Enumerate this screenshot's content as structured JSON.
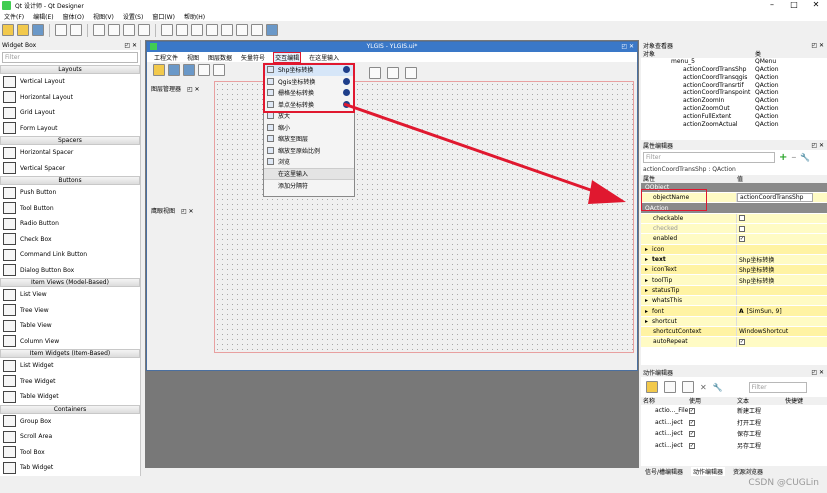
{
  "app": {
    "title": "Qt 设计师 - Qt Designer"
  },
  "menubar": [
    "文件(F)",
    "编辑(E)",
    "窗体(O)",
    "视图(V)",
    "设置(S)",
    "窗口(W)",
    "帮助(H)"
  ],
  "widget_box": {
    "title": "Widget Box",
    "filter_placeholder": "Filter",
    "categories": [
      {
        "name": "Layouts",
        "items": [
          "Vertical Layout",
          "Horizontal Layout",
          "Grid Layout",
          "Form Layout"
        ]
      },
      {
        "name": "Spacers",
        "items": [
          "Horizontal Spacer",
          "Vertical Spacer"
        ]
      },
      {
        "name": "Buttons",
        "items": [
          "Push Button",
          "Tool Button",
          "Radio Button",
          "Check Box",
          "Command Link Button",
          "Dialog Button Box"
        ]
      },
      {
        "name": "Item Views (Model-Based)",
        "items": [
          "List View",
          "Tree View",
          "Table View",
          "Column View"
        ]
      },
      {
        "name": "Item Widgets (Item-Based)",
        "items": [
          "List Widget",
          "Tree Widget",
          "Table Widget"
        ]
      },
      {
        "name": "Containers",
        "items": [
          "Group Box",
          "Scroll Area",
          "Tool Box",
          "Tab Widget"
        ]
      }
    ]
  },
  "form": {
    "title": "YLGIS - YLGIS.ui*",
    "menus": [
      "工程文件",
      "视图",
      "图层数据",
      "矢量符号",
      "交互编辑",
      "在这里输入"
    ],
    "dock_left": "图层管理器",
    "dock_eagle": "鹰眼视图",
    "dropdown_items": [
      {
        "label": "Shp坐标转换",
        "icon": "action-icon",
        "group": "red"
      },
      {
        "label": "Qgis坐标转换",
        "icon": "action-icon",
        "group": "red"
      },
      {
        "label": "栅格坐标转换",
        "icon": "action-icon",
        "group": "red"
      },
      {
        "label": "单点坐标转换",
        "icon": "action-icon",
        "group": "red"
      },
      {
        "label": "放大",
        "icon": "zoom-in-icon"
      },
      {
        "label": "缩小",
        "icon": "zoom-out-icon"
      },
      {
        "label": "缩放至图层",
        "icon": "zoom-layer-icon"
      },
      {
        "label": "缩放至原始比例",
        "icon": "zoom-original-icon"
      },
      {
        "label": "浏览",
        "icon": "pan-hand-icon"
      },
      {
        "label": "在这里输入",
        "icon": ""
      },
      {
        "label": "添加分隔符",
        "icon": ""
      }
    ]
  },
  "object_inspector": {
    "title": "对象查看器",
    "headers": [
      "对象",
      "类"
    ],
    "rows": [
      {
        "object": "menu_5",
        "class": "QMenu",
        "indent": 1
      },
      {
        "object": "actionCoordTransShp",
        "class": "QAction",
        "indent": 2
      },
      {
        "object": "actionCoordTransqgis",
        "class": "QAction",
        "indent": 2
      },
      {
        "object": "actionCoordTransrtif",
        "class": "QAction",
        "indent": 2
      },
      {
        "object": "actionCoordTranspoint",
        "class": "QAction",
        "indent": 2
      },
      {
        "object": "actionZoomIn",
        "class": "QAction",
        "indent": 2
      },
      {
        "object": "actionZoomOut",
        "class": "QAction",
        "indent": 2
      },
      {
        "object": "actionFullExtent",
        "class": "QAction",
        "indent": 2
      },
      {
        "object": "actionZoomActual",
        "class": "QAction",
        "indent": 2
      }
    ]
  },
  "property_editor": {
    "title": "属性编辑器",
    "filter_placeholder": "Filter",
    "context": "actionCoordTransShp : QAction",
    "headers": [
      "属性",
      "值"
    ],
    "rows": [
      {
        "k": "QObject",
        "v": "",
        "type": "group"
      },
      {
        "k": "objectName",
        "v": "actionCoordTransShp",
        "type": "yel"
      },
      {
        "k": "QAction",
        "v": "",
        "type": "group"
      },
      {
        "k": "checkable",
        "v": "",
        "type": "yel",
        "check": false
      },
      {
        "k": "checked",
        "v": "",
        "type": "yel",
        "check": false,
        "dim": true
      },
      {
        "k": "enabled",
        "v": "",
        "type": "yel",
        "check": true
      },
      {
        "k": "icon",
        "v": "",
        "type": "yel2",
        "expand": true
      },
      {
        "k": "text",
        "v": "Shp坐标转换",
        "type": "yel",
        "expand": true,
        "bold": true
      },
      {
        "k": "iconText",
        "v": "Shp坐标转换",
        "type": "yel2",
        "expand": true
      },
      {
        "k": "toolTip",
        "v": "Shp坐标转换",
        "type": "yel",
        "expand": true
      },
      {
        "k": "statusTip",
        "v": "",
        "type": "yel2",
        "expand": true
      },
      {
        "k": "whatsThis",
        "v": "",
        "type": "yel",
        "expand": true
      },
      {
        "k": "font",
        "v": "[SimSun, 9]",
        "type": "yel2",
        "expand": true,
        "font": "A"
      },
      {
        "k": "shortcut",
        "v": "",
        "type": "yel",
        "expand": true
      },
      {
        "k": "shortcutContext",
        "v": "WindowShortcut",
        "type": "yel2"
      },
      {
        "k": "autoRepeat",
        "v": "",
        "type": "yel",
        "check": true
      }
    ]
  },
  "action_editor": {
    "title": "动作编辑器",
    "filter_placeholder": "Filter",
    "headers": [
      "名称",
      "使用",
      "文本",
      "快捷键"
    ],
    "rows": [
      {
        "name": "actio..._File",
        "text": "新建工程"
      },
      {
        "name": "acti...ject",
        "text": "打开工程"
      },
      {
        "name": "acti...ject",
        "text": "保存工程"
      },
      {
        "name": "acti...ject",
        "text": "另存工程"
      }
    ],
    "tabs": [
      "信号/槽编辑器",
      "动作编辑器",
      "资源浏览器"
    ]
  },
  "watermark": "CSDN @CUGLin"
}
